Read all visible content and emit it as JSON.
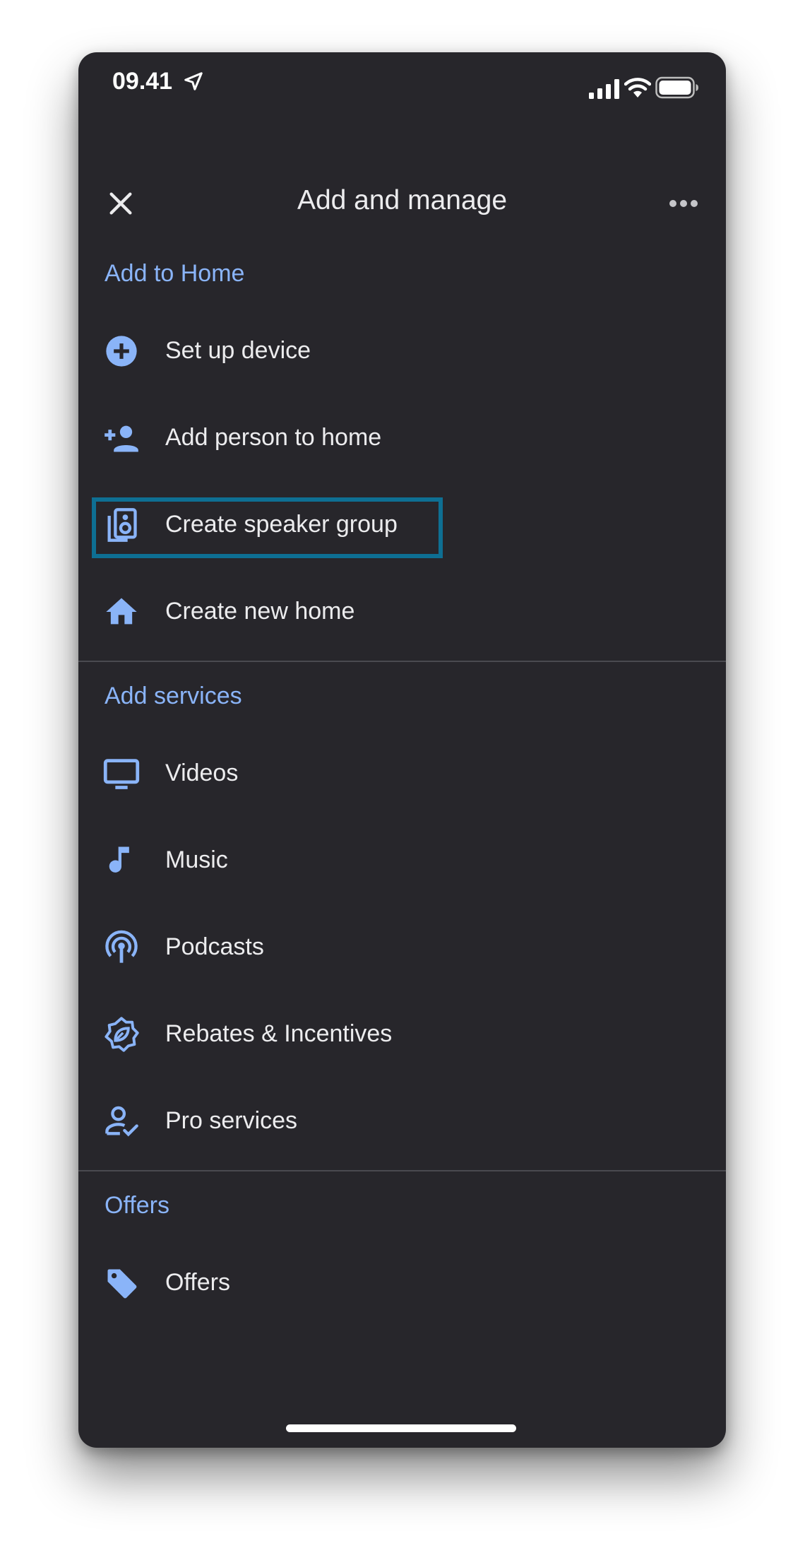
{
  "status_bar": {
    "time": "09.41"
  },
  "header": {
    "title": "Add and manage"
  },
  "sections": [
    {
      "title": "Add to Home",
      "items": [
        {
          "label": "Set up device",
          "icon": "add-circle-icon"
        },
        {
          "label": "Add person to home",
          "icon": "person-add-icon"
        },
        {
          "label": "Create speaker group",
          "icon": "speaker-group-icon"
        },
        {
          "label": "Create new home",
          "icon": "home-icon"
        }
      ]
    },
    {
      "title": "Add services",
      "items": [
        {
          "label": "Videos",
          "icon": "tv-icon"
        },
        {
          "label": "Music",
          "icon": "music-note-icon"
        },
        {
          "label": "Podcasts",
          "icon": "podcast-icon"
        },
        {
          "label": "Rebates & Incentives",
          "icon": "rebate-badge-icon"
        },
        {
          "label": "Pro services",
          "icon": "person-check-icon"
        }
      ]
    },
    {
      "title": "Offers",
      "items": [
        {
          "label": "Offers",
          "icon": "tag-icon"
        }
      ]
    }
  ],
  "colors": {
    "background": "#27262b",
    "accent": "#8ab4f8",
    "text": "#ececee",
    "highlight_border": "#0e6f93"
  }
}
